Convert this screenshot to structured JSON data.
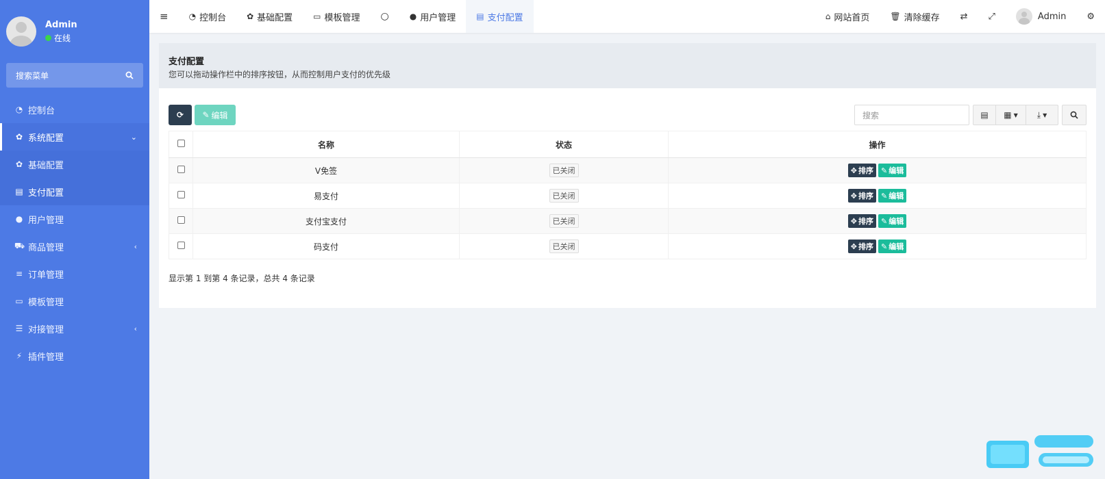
{
  "sidebar": {
    "user": {
      "name": "Admin",
      "status": "在线"
    },
    "search_placeholder": "搜索菜单",
    "items": [
      {
        "label": "控制台",
        "icon": "dashboard-icon"
      },
      {
        "label": "系统配置",
        "icon": "gear-icon"
      },
      {
        "label": "基础配置",
        "icon": "gear-icon"
      },
      {
        "label": "支付配置",
        "icon": "list-icon"
      },
      {
        "label": "用户管理",
        "icon": "user-icon"
      },
      {
        "label": "商品管理",
        "icon": "cart-icon"
      },
      {
        "label": "订单管理",
        "icon": "bars-icon"
      },
      {
        "label": "模板管理",
        "icon": "template-icon"
      },
      {
        "label": "对接管理",
        "icon": "sliders-icon"
      },
      {
        "label": "插件管理",
        "icon": "plug-icon"
      }
    ]
  },
  "topbar": {
    "tabs": [
      {
        "label": "控制台"
      },
      {
        "label": "基础配置"
      },
      {
        "label": "模板管理"
      },
      {
        "label": ""
      },
      {
        "label": "用户管理"
      },
      {
        "label": "支付配置"
      }
    ],
    "right": {
      "home": "网站首页",
      "clear_cache": "清除缓存",
      "user": "Admin"
    }
  },
  "page": {
    "title": "支付配置",
    "description": "您可以拖动操作栏中的排序按钮，从而控制用户支付的优先级"
  },
  "toolbar": {
    "edit_label": "编辑",
    "search_placeholder": "搜索"
  },
  "table": {
    "headers": [
      "名称",
      "状态",
      "操作"
    ],
    "rows": [
      {
        "name": "V免签",
        "status": "已关闭"
      },
      {
        "name": "易支付",
        "status": "已关闭"
      },
      {
        "name": "支付宝支付",
        "status": "已关闭"
      },
      {
        "name": "码支付",
        "status": "已关闭"
      }
    ],
    "sort_label": "排序",
    "edit_label": "编辑"
  },
  "pagination": {
    "info": "显示第 1 到第 4 条记录，总共 4 条记录"
  },
  "colors": {
    "sidebar_bg": "#4d7ae5",
    "dark_button": "#2c3e50",
    "teal_button": "#1bbc9b",
    "online_dot": "#3cd54a"
  }
}
